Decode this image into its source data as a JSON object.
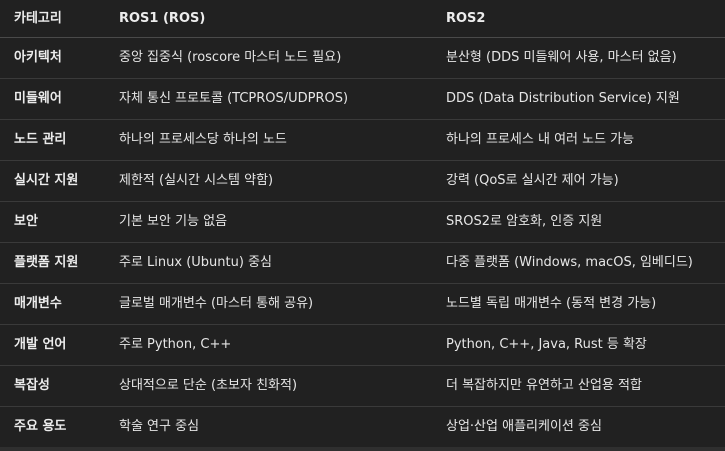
{
  "table": {
    "headers": [
      "카테고리",
      "ROS1 (ROS)",
      "ROS2"
    ],
    "rows": [
      [
        "아키텍처",
        "중앙 집중식 (roscore 마스터 노드 필요)",
        "분산형 (DDS 미들웨어 사용, 마스터 없음)"
      ],
      [
        "미들웨어",
        "자체 통신 프로토콜 (TCPROS/UDPROS)",
        "DDS (Data Distribution Service) 지원"
      ],
      [
        "노드 관리",
        "하나의 프로세스당 하나의 노드",
        "하나의 프로세스 내 여러 노드 가능"
      ],
      [
        "실시간 지원",
        "제한적 (실시간 시스템 약함)",
        "강력 (QoS로 실시간 제어 가능)"
      ],
      [
        "보안",
        "기본 보안 기능 없음",
        "SROS2로 암호화, 인증 지원"
      ],
      [
        "플랫폼 지원",
        "주로 Linux (Ubuntu) 중심",
        "다중 플랫폼 (Windows, macOS, 임베디드)"
      ],
      [
        "매개변수",
        "글로벌 매개변수 (마스터 통해 공유)",
        "노드별 독립 매개변수 (동적 변경 가능)"
      ],
      [
        "개발 언어",
        "주로 Python, C++",
        "Python, C++, Java, Rust 등 확장"
      ],
      [
        "복잡성",
        "상대적으로 단순 (초보자 친화적)",
        "더 복잡하지만 유연하고 산업용 적합"
      ],
      [
        "주요 용도",
        "학술 연구 중심",
        "상업·산업 애플리케이션 중심"
      ]
    ]
  }
}
